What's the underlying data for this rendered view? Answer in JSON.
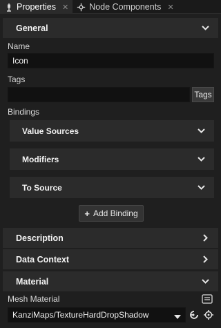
{
  "tabs": [
    {
      "label": "Properties",
      "active": true
    },
    {
      "label": "Node Components",
      "active": false
    }
  ],
  "sections": {
    "general": "General",
    "description": "Description",
    "data_context": "Data Context",
    "material": "Material"
  },
  "fields": {
    "name_label": "Name",
    "name_value": "Icon",
    "tags_label": "Tags",
    "tags_value": "",
    "tags_button": "Tags",
    "bindings_label": "Bindings",
    "mesh_material_label": "Mesh Material",
    "mesh_material_value": "KanziMaps/TextureHardDropShadow"
  },
  "bindings": {
    "value_sources": "Value Sources",
    "modifiers": "Modifiers",
    "to_source": "To Source",
    "add_binding": "Add Binding"
  },
  "colors": {
    "background": "#1f1f1f",
    "section_bg": "#2b2b2b",
    "input_bg": "#111111"
  }
}
